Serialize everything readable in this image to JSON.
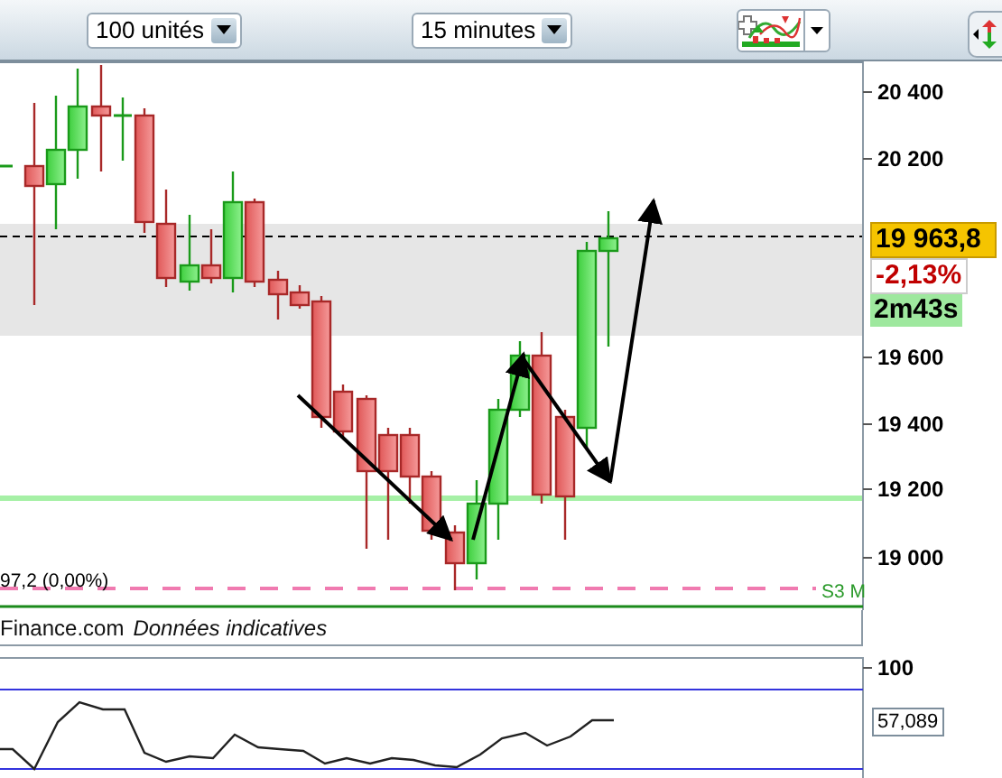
{
  "toolbar": {
    "quantity": {
      "value": "100 unités"
    },
    "period": {
      "value": "15 minutes"
    }
  },
  "price_chart": {
    "y_axis_labels": [
      "20 400",
      "20 200",
      "19 600",
      "19 400",
      "19 200",
      "19 000"
    ],
    "last_price": "19 963,8",
    "change": "-2,13%",
    "countdown": "2m43s",
    "pivot_label": "97,2 (0,00%)",
    "level_label": "S3 M"
  },
  "source_bar": {
    "source": "Finance.com",
    "note": "Données indicatives"
  },
  "oscillator": {
    "y_axis_labels": [
      "100"
    ],
    "value": "57,089"
  }
}
